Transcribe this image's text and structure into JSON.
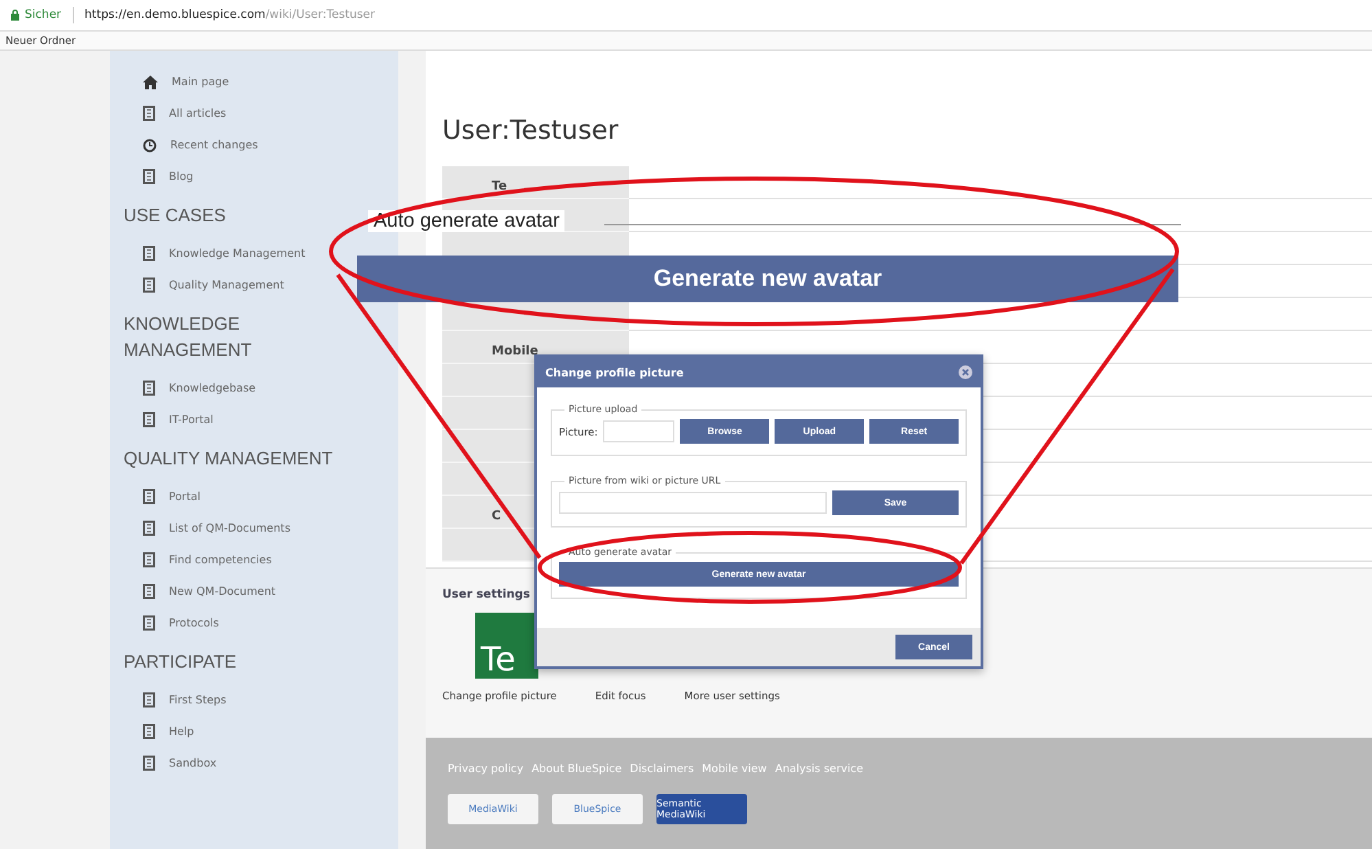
{
  "browser": {
    "secure_label": "Sicher",
    "url_host": "https://en.demo.bluespice.com",
    "url_path": "/wiki/User:Testuser",
    "bookmarks": [
      "Neuer Ordner"
    ]
  },
  "sidebar": [
    {
      "items": [
        {
          "label": "Main page",
          "kind": "home"
        },
        {
          "label": "All articles",
          "kind": "page"
        },
        {
          "label": "Recent changes",
          "kind": "clock"
        },
        {
          "label": "Blog",
          "kind": "page"
        }
      ]
    },
    {
      "heading": "USE CASES",
      "items": [
        {
          "label": "Knowledge Management",
          "kind": "page"
        },
        {
          "label": "Quality Management",
          "kind": "page"
        }
      ]
    },
    {
      "heading": "KNOWLEDGE MANAGEMENT",
      "items": [
        {
          "label": "Knowledgebase",
          "kind": "page"
        },
        {
          "label": "IT-Portal",
          "kind": "page"
        }
      ]
    },
    {
      "heading": "QUALITY MANAGEMENT",
      "items": [
        {
          "label": "Portal",
          "kind": "page"
        },
        {
          "label": "List of QM-Documents",
          "kind": "page"
        },
        {
          "label": "Find competencies",
          "kind": "page"
        },
        {
          "label": "New QM-Document",
          "kind": "page"
        },
        {
          "label": "Protocols",
          "kind": "page"
        }
      ]
    },
    {
      "heading": "PARTICIPATE",
      "items": [
        {
          "label": "First Steps",
          "kind": "page"
        },
        {
          "label": "Help",
          "kind": "page"
        },
        {
          "label": "Sandbox",
          "kind": "page"
        }
      ]
    }
  ],
  "page": {
    "title": "User:Testuser",
    "table_rows": [
      {
        "label": "Te"
      },
      {
        "label": "Mobile"
      },
      {
        "label": "C"
      }
    ]
  },
  "user_settings": {
    "heading": "User settings",
    "avatar_text": "Te",
    "links": [
      "Change profile picture",
      "Edit focus",
      "More user settings"
    ]
  },
  "footer": {
    "links": [
      "Privacy policy",
      "About BlueSpice",
      "Disclaimers",
      "Mobile view",
      "Analysis service"
    ],
    "badges": [
      "MediaWiki",
      "BlueSpice",
      "Semantic MediaWiki"
    ]
  },
  "dialog": {
    "title": "Change profile picture",
    "sections": [
      {
        "legend": "Picture upload",
        "kind": "upload",
        "field_label": "Picture:",
        "buttons": [
          "Browse",
          "Upload",
          "Reset"
        ]
      },
      {
        "legend": "Picture from wiki or picture URL",
        "kind": "url",
        "buttons": [
          "Save"
        ]
      },
      {
        "legend": "Auto generate avatar",
        "kind": "generate",
        "buttons": [
          "Generate new avatar"
        ]
      }
    ],
    "footer_buttons": [
      "Cancel"
    ]
  },
  "callout": {
    "legend": "Auto generate avatar",
    "button": "Generate new avatar"
  }
}
